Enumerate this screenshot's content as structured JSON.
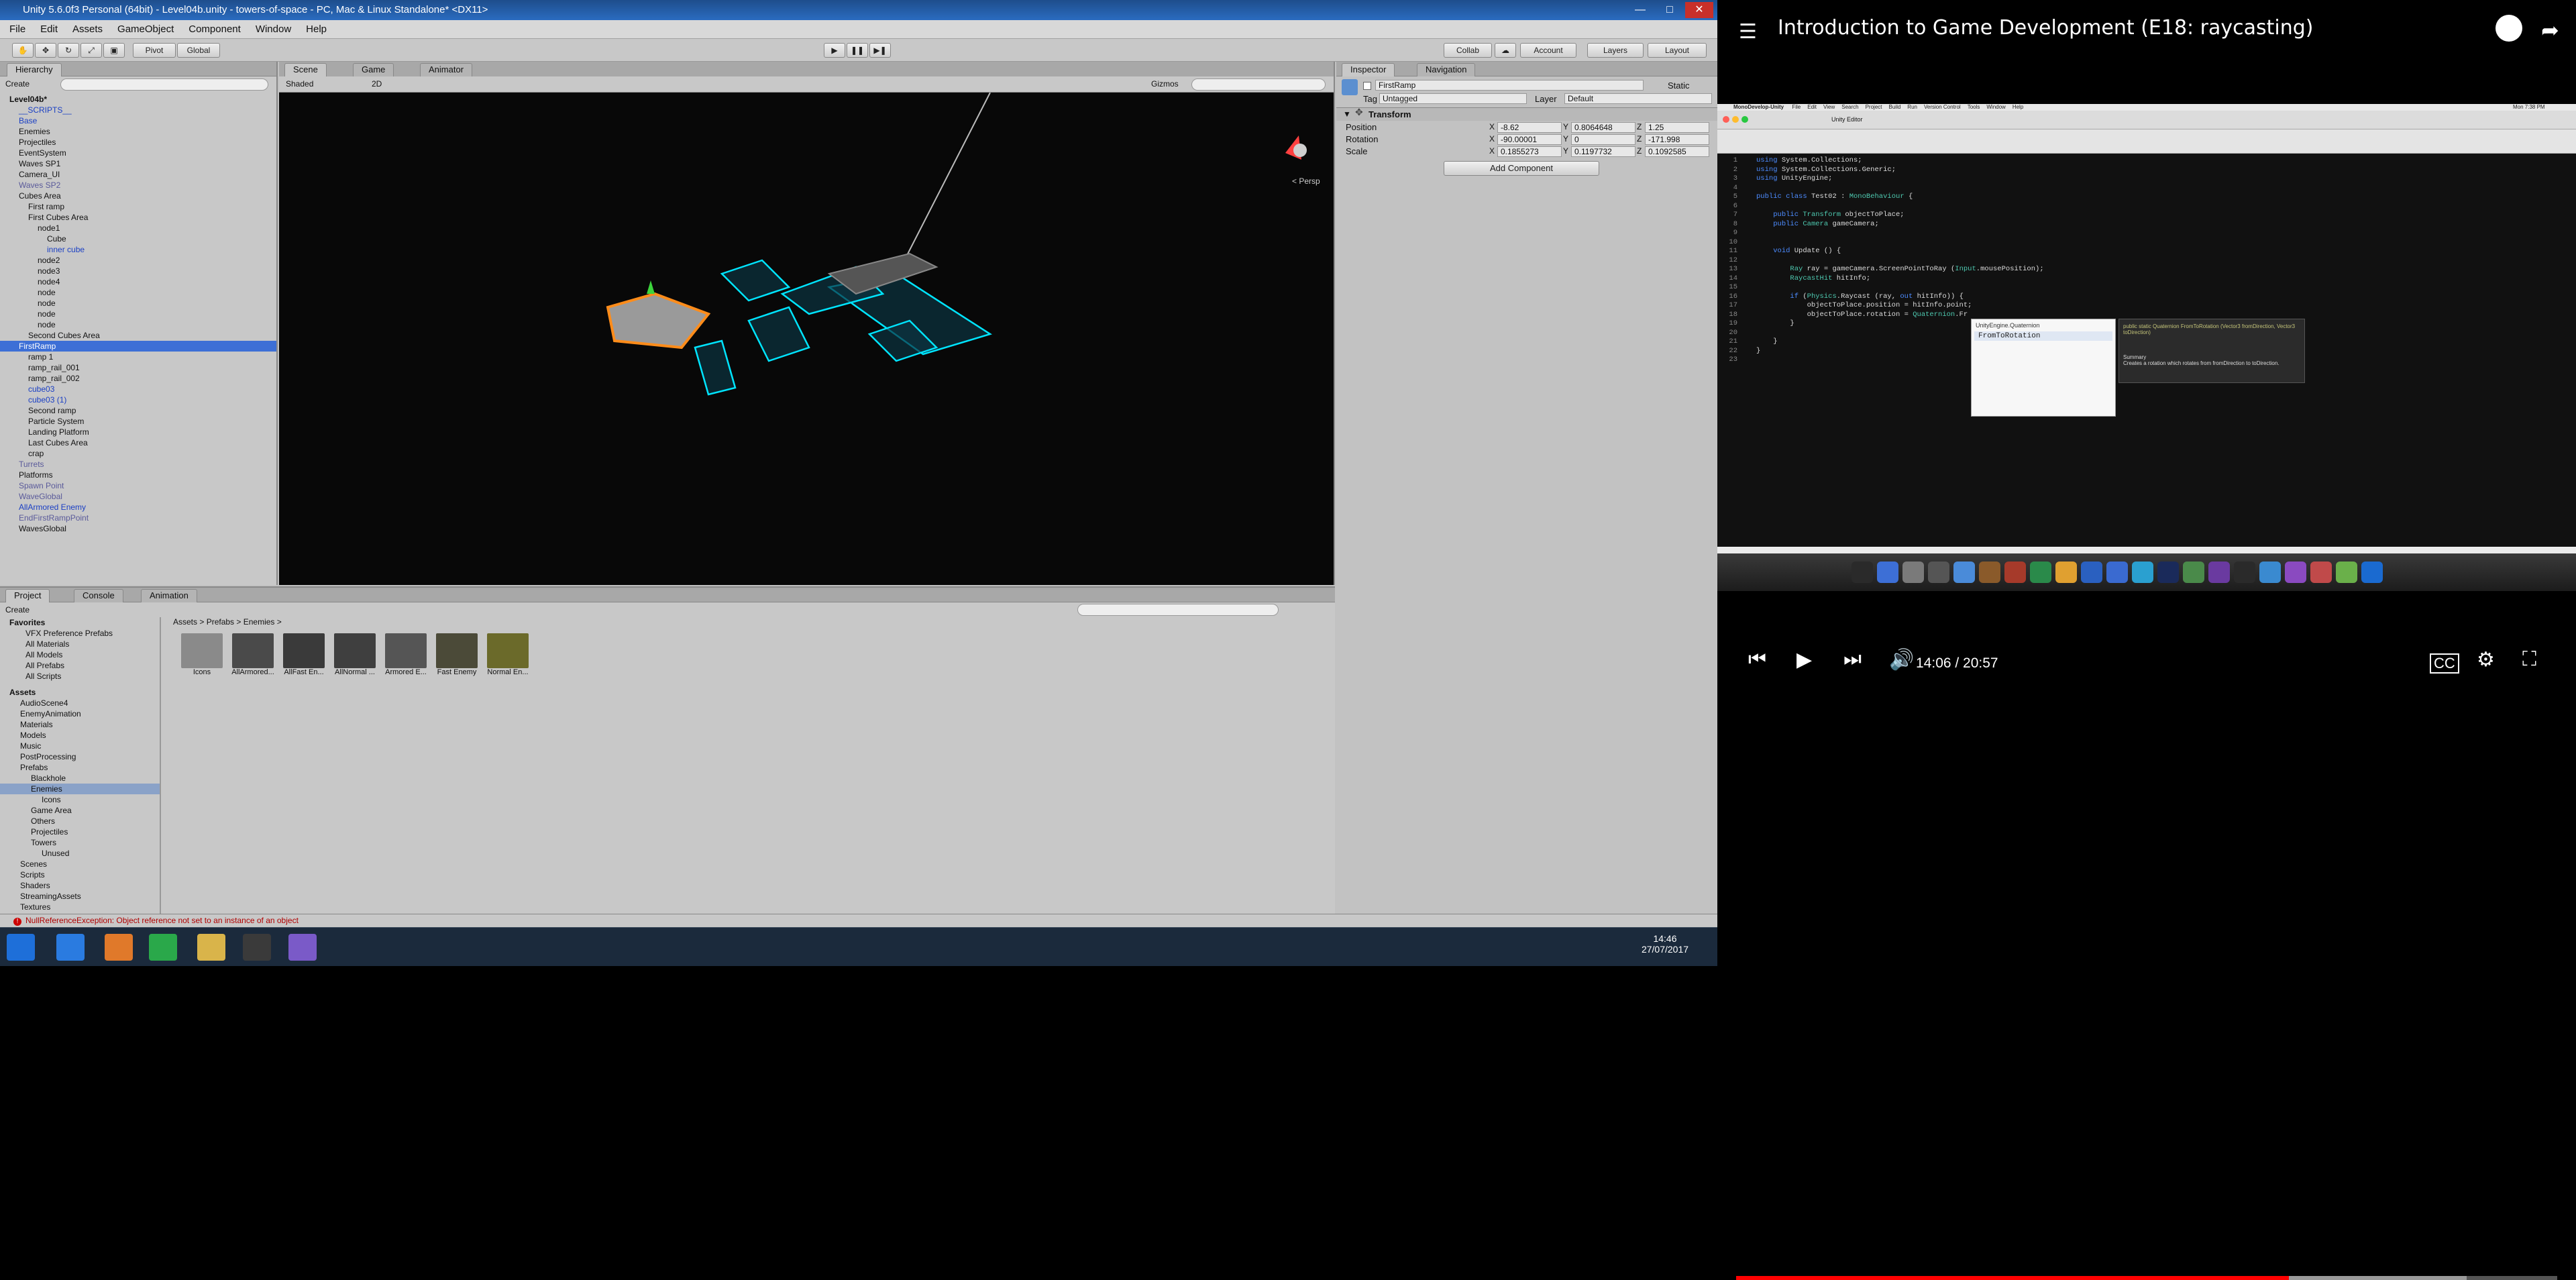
{
  "window_title": "Unity 5.6.0f3 Personal (64bit) - Level04b.unity - towers-of-space - PC, Mac & Linux Standalone* <DX11>",
  "menu": [
    "File",
    "Edit",
    "Assets",
    "GameObject",
    "Component",
    "Window",
    "Help"
  ],
  "toolbar": {
    "pivot": "Pivot",
    "global": "Global",
    "collab": "Collab",
    "account": "Account",
    "layers": "Layers",
    "layout": "Layout"
  },
  "hierarchy": {
    "tab": "Hierarchy",
    "create": "Create",
    "items": [
      {
        "label": "Level04b*",
        "style": "bold"
      },
      {
        "label": "__SCRIPTS__",
        "style": "blue"
      },
      {
        "label": "Base",
        "style": "blue"
      },
      {
        "label": "Enemies",
        "style": ""
      },
      {
        "label": "Projectiles",
        "style": ""
      },
      {
        "label": "EventSystem",
        "style": ""
      },
      {
        "label": "Waves SP1",
        "style": ""
      },
      {
        "label": "Camera_UI",
        "style": ""
      },
      {
        "label": "Waves SP2",
        "style": "grey"
      },
      {
        "label": "Cubes Area",
        "style": ""
      },
      {
        "label": "First ramp",
        "style": ""
      },
      {
        "label": "First Cubes Area",
        "style": ""
      },
      {
        "label": "node1",
        "style": ""
      },
      {
        "label": "Cube",
        "style": ""
      },
      {
        "label": "inner cube",
        "style": "blue"
      },
      {
        "label": "node2",
        "style": ""
      },
      {
        "label": "node3",
        "style": ""
      },
      {
        "label": "node4",
        "style": ""
      },
      {
        "label": "node",
        "style": ""
      },
      {
        "label": "node",
        "style": ""
      },
      {
        "label": "node",
        "style": ""
      },
      {
        "label": "node",
        "style": ""
      },
      {
        "label": "Second Cubes Area",
        "style": ""
      },
      {
        "label": "FirstRamp",
        "style": "sel"
      },
      {
        "label": "ramp 1",
        "style": ""
      },
      {
        "label": "ramp_rail_001",
        "style": ""
      },
      {
        "label": "ramp_rail_002",
        "style": ""
      },
      {
        "label": "cube03",
        "style": "blue"
      },
      {
        "label": "cube03 (1)",
        "style": "blue"
      },
      {
        "label": "Second ramp",
        "style": ""
      },
      {
        "label": "Particle System",
        "style": ""
      },
      {
        "label": "Landing Platform",
        "style": ""
      },
      {
        "label": "Last Cubes Area",
        "style": ""
      },
      {
        "label": "crap",
        "style": ""
      },
      {
        "label": "Turrets",
        "style": "grey"
      },
      {
        "label": "Platforms",
        "style": ""
      },
      {
        "label": "Spawn Point",
        "style": "grey"
      },
      {
        "label": "WaveGlobal",
        "style": "grey"
      },
      {
        "label": "AllArmored Enemy",
        "style": "blue"
      },
      {
        "label": "EndFirstRampPoint",
        "style": "grey"
      },
      {
        "label": "WavesGlobal",
        "style": ""
      }
    ]
  },
  "scene": {
    "tabs": [
      "Scene",
      "Game",
      "Animator"
    ],
    "shaded": "Shaded",
    "mode_2d": "2D",
    "gizmos": "Gizmos",
    "persp": "< Persp"
  },
  "inspector": {
    "tabs": [
      "Inspector",
      "Navigation"
    ],
    "object_name": "FirstRamp",
    "static": "Static",
    "tag_label": "Tag",
    "tag": "Untagged",
    "layer_label": "Layer",
    "layer": "Default",
    "component": "Transform",
    "rows": [
      {
        "label": "Position",
        "x": "-8.62",
        "y": "0.8064648",
        "z": "1.25"
      },
      {
        "label": "Rotation",
        "x": "-90.00001",
        "y": "0",
        "z": "-171.998"
      },
      {
        "label": "Scale",
        "x": "0.1855273",
        "y": "0.1197732",
        "z": "0.1092585"
      }
    ],
    "add_component": "Add Component"
  },
  "project": {
    "tabs": [
      "Project",
      "Console",
      "Animation"
    ],
    "create": "Create",
    "breadcrumb": "Assets > Prefabs > Enemies >",
    "favorites": [
      "Favorites",
      "VFX Preference Prefabs",
      "All Materials",
      "All Models",
      "All Prefabs",
      "All Scripts"
    ],
    "assets_tree": [
      "Assets",
      "AudioScene4",
      "EnemyAnimation",
      "Materials",
      "Models",
      "Music",
      "PostProcessing",
      "Prefabs",
      "Blackhole",
      "Enemies",
      "Icons",
      "Game Area",
      "Others",
      "Projectiles",
      "Towers",
      "Unused",
      "Scenes",
      "Scripts",
      "Shaders",
      "StreamingAssets",
      "Textures"
    ],
    "items": [
      {
        "label": "Icons",
        "color": "#8a8a8a"
      },
      {
        "label": "AllArmored...",
        "color": "#4a4a4a"
      },
      {
        "label": "AllFast En...",
        "color": "#3a3a3a"
      },
      {
        "label": "AllNormal ...",
        "color": "#3f3f3f"
      },
      {
        "label": "Armored E...",
        "color": "#555555"
      },
      {
        "label": "Fast Enemy",
        "color": "#4b4a38"
      },
      {
        "label": "Normal En...",
        "color": "#6b6a2a"
      }
    ]
  },
  "status": "NullReferenceException: Object reference not set to an instance of an object",
  "taskbar": {
    "time": "14:46",
    "date": "27/07/2017"
  },
  "video": {
    "title": "Introduction to Game Development (E18: raycasting)",
    "time": "14:06 / 20:57",
    "progress": 0.673,
    "buffered": 0.89,
    "mac_app": "MonoDevelop-Unity",
    "mac_menu": [
      "File",
      "Edit",
      "View",
      "Search",
      "Project",
      "Build",
      "Run",
      "Version Control",
      "Tools",
      "Window",
      "Help"
    ],
    "mac_clock": "Mon 7:38 PM",
    "editor_title": "Unity Editor",
    "code_lines": [
      "using System.Collections;",
      "using System.Collections.Generic;",
      "using UnityEngine;",
      "",
      "public class Test02 : MonoBehaviour {",
      "",
      "    public Transform objectToPlace;",
      "    public Camera gameCamera;",
      "",
      "",
      "    void Update () {",
      "",
      "        Ray ray = gameCamera.ScreenPointToRay (Input.mousePosition);",
      "        RaycastHit hitInfo;",
      "",
      "        if (Physics.Raycast (ray, out hitInfo)) {",
      "            objectToPlace.position = hitInfo.point;",
      "            objectToPlace.rotation = Quaternion.Fr",
      "        }",
      "",
      "    }",
      "}",
      ""
    ],
    "autocomplete_header": "UnityEngine.Quaternion",
    "autocomplete_item": "FromToRotation",
    "tooltip_sig": "public static Quaternion FromToRotation (Vector3 fromDirection, Vector3 toDirection)",
    "tooltip_summary": "Summary",
    "tooltip_desc": "Creates a rotation which rotates from fromDirection to toDirection."
  },
  "colors": {
    "accent": "#ff0000",
    "selection": "#3d6fd6",
    "cyan": "#00e5ff",
    "orange": "#ff8c1a"
  }
}
